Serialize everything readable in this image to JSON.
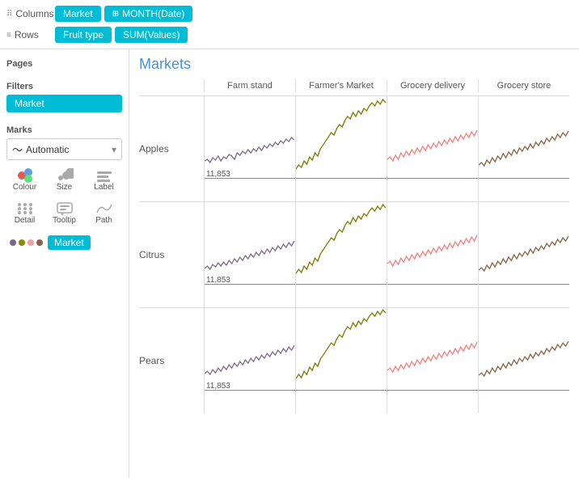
{
  "toolbar": {
    "columns_icon": "⠿",
    "columns_label": "Columns",
    "rows_icon": "≡",
    "rows_label": "Rows",
    "market_pill": "Market",
    "month_pill": "MONTH(Date)",
    "fruit_type_pill": "Fruit type",
    "sum_values_pill": "SUM(Values)"
  },
  "sidebar": {
    "pages_title": "Pages",
    "filters_title": "Filters",
    "filter_market": "Market",
    "marks_title": "Marks",
    "marks_auto": "Automatic",
    "colour_label": "Colour",
    "size_label": "Size",
    "label_label": "Label",
    "detail_label": "Detail",
    "tooltip_label": "Tooltip",
    "path_label": "Path",
    "market_color_label": "Market"
  },
  "chart": {
    "title": "Markets",
    "headers": [
      "Farm stand",
      "Farmer's Market",
      "Grocery delivery",
      "Grocery store"
    ],
    "rows": [
      {
        "label": "Apples",
        "value": "11,853"
      },
      {
        "label": "Citrus",
        "value": "11,853"
      },
      {
        "label": "Pears",
        "value": "11,853"
      }
    ]
  },
  "colors": {
    "teal": "#00bcd4",
    "purple": "#7b6888",
    "olive": "#7b7b00",
    "pink": "#f48080",
    "brown": "#8b6347"
  }
}
